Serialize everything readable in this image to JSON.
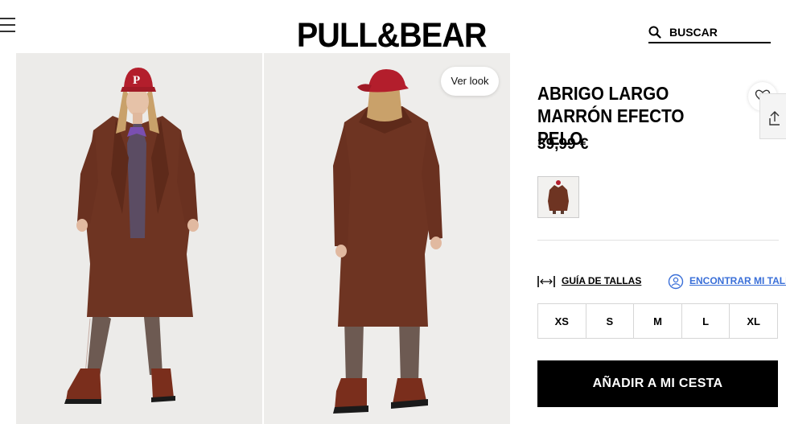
{
  "header": {
    "logo": "PULL&BEAR",
    "search": {
      "placeholder": "BUSCAR",
      "value": ""
    }
  },
  "gallery": {
    "images": [
      {
        "alt": "Modelo con abrigo marrón de frente"
      },
      {
        "alt": "Modelo con abrigo marrón de espaldas"
      }
    ],
    "ver_look_label": "Ver look"
  },
  "product": {
    "title": "ABRIGO LARGO MARRÓN EFECTO PELO",
    "price": "39,99 €",
    "size_guide_label": "GUÍA DE TALLAS",
    "find_size_label": "ENCONTRAR MI TALLA",
    "sizes": [
      "XS",
      "S",
      "M",
      "L",
      "XL"
    ],
    "add_to_cart_label": "AÑADIR A MI CESTA"
  },
  "colors": {
    "accent_link": "#3a6fd8",
    "coat": "#6e3422",
    "cap": "#b31e2c",
    "button_bg": "#000000"
  }
}
